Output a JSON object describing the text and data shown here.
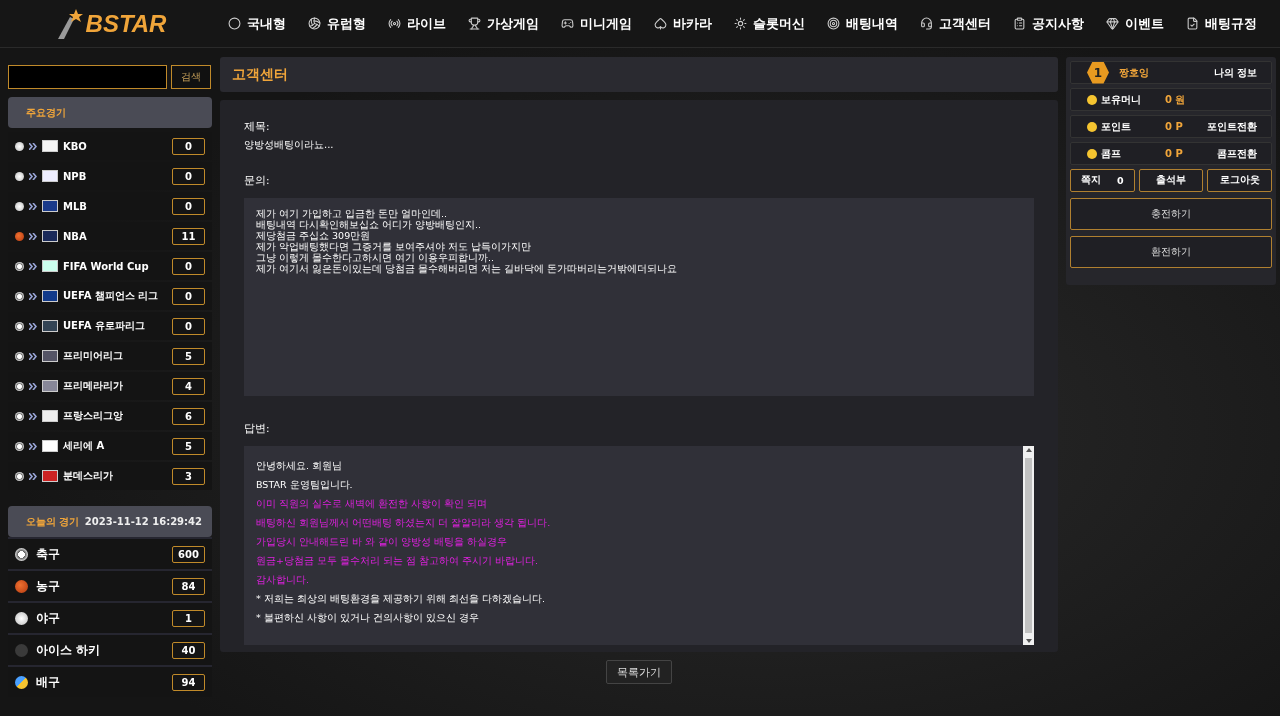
{
  "logo": {
    "text": "BSTAR"
  },
  "nav": [
    {
      "label": "국내형"
    },
    {
      "label": "유럽형"
    },
    {
      "label": "라이브"
    },
    {
      "label": "가상게임"
    },
    {
      "label": "미니게임"
    },
    {
      "label": "바카라"
    },
    {
      "label": "슬롯머신"
    },
    {
      "label": "배팅내역"
    },
    {
      "label": "고객센터"
    },
    {
      "label": "공지사항"
    },
    {
      "label": "이벤트"
    },
    {
      "label": "배팅규정"
    }
  ],
  "search": {
    "button": "검색"
  },
  "major_games": {
    "title": "주요경기",
    "items": [
      {
        "kind": "baseball",
        "name": "KBO",
        "count": "0"
      },
      {
        "kind": "baseball",
        "name": "NPB",
        "count": "0"
      },
      {
        "kind": "baseball",
        "name": "MLB",
        "count": "0"
      },
      {
        "kind": "basketball",
        "name": "NBA",
        "count": "11"
      },
      {
        "kind": "soccer",
        "name": "FIFA World Cup",
        "count": "0"
      },
      {
        "kind": "soccer",
        "name": "UEFA 챔피언스 리그",
        "count": "0"
      },
      {
        "kind": "soccer",
        "name": "UEFA 유로파리그",
        "count": "0"
      },
      {
        "kind": "soccer",
        "name": "프리미어리그",
        "count": "5"
      },
      {
        "kind": "soccer",
        "name": "프리메라리가",
        "count": "4"
      },
      {
        "kind": "soccer",
        "name": "프랑스리그앙",
        "count": "6"
      },
      {
        "kind": "soccer",
        "name": "세리에 A",
        "count": "5"
      },
      {
        "kind": "soccer",
        "name": "분데스리가",
        "count": "3"
      }
    ]
  },
  "today_games": {
    "title": "오늘의 경기",
    "datetime": "2023-11-12 16:29:42",
    "items": [
      {
        "kind": "soccer",
        "name": "축구",
        "count": "600"
      },
      {
        "kind": "basketball",
        "name": "농구",
        "count": "84"
      },
      {
        "kind": "baseball",
        "name": "야구",
        "count": "1"
      },
      {
        "kind": "hockey",
        "name": "아이스 하키",
        "count": "40"
      },
      {
        "kind": "volleyball",
        "name": "배구",
        "count": "94"
      }
    ]
  },
  "page_title": "고객센터",
  "post": {
    "subject_label": "제목:",
    "subject": "양방성배팅이라뇨...",
    "inquiry_label": "문의:",
    "inquiry": [
      "제가 여기 가입하고 입금한 돈만 얼마인데..",
      "배팅내역 다시확인해보십쇼 어디가 양방배팅인지..",
      "제당첨금 주십쇼 309만원",
      "제가 악업배팅했다면 그증거를 보여주셔야 저도 납득이가지만",
      "그냥 이렇게 몰수한다고하시면 여기 이용우피합니까..",
      "제가 여기서 잃은돈이있는데 당첨금 몰수해버리면 저는 길바닥에 돈가따버리는거밖에더되나요"
    ],
    "answer_label": "답변:",
    "answer": [
      {
        "text": "안녕하세요. 회원님",
        "highlight": false
      },
      {
        "text": "BSTAR 운영팀입니다.",
        "highlight": false
      },
      {
        "text": "이미 직원의 실수로 새벽에 환전한 사항이 확인 되며",
        "highlight": true
      },
      {
        "text": "배팅하신 회원님께서 어떤배팅 하셨는지 더 잘알리라 생각 됩니다.",
        "highlight": true
      },
      {
        "text": "가입당시 안내해드린 바 와 같이 양방성 배팅을 하실경우",
        "highlight": true
      },
      {
        "text": "원금+당첨금 모두 몰수처리 되는 점 참고하여 주시기 바랍니다.",
        "highlight": true
      },
      {
        "text": "감사합니다.",
        "highlight": true
      },
      {
        "text": "* 저희는 최상의 배팅환경을 제공하기 위해 최선을 다하겠습니다.",
        "highlight": false
      },
      {
        "text": "* 불편하신 사항이 있거나 건의사항이 있으신 경우",
        "highlight": false
      }
    ],
    "back_button": "목록가기"
  },
  "account": {
    "level": "1",
    "nickname": "짱호잉",
    "my_info": "나의 정보",
    "rows": [
      {
        "label": "보유머니",
        "value": "0 원"
      },
      {
        "label": "포인트",
        "value": "0 P",
        "action": "포인트전환"
      },
      {
        "label": "콤프",
        "value": "0 P",
        "action": "콤프전환"
      }
    ],
    "memo_label": "쪽지",
    "memo_count": "0",
    "attendance": "출석부",
    "logout": "로그아웃",
    "deposit": "충전하기",
    "withdraw": "환전하기"
  }
}
